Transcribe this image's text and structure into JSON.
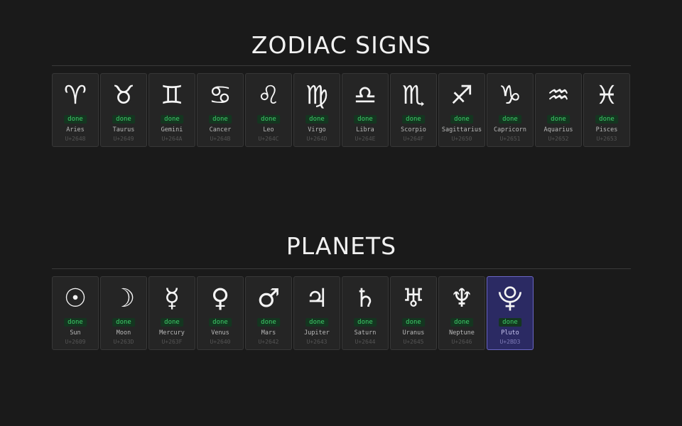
{
  "zodiac": {
    "title": "ZODIAC SIGNS",
    "items": [
      {
        "glyph": "♈",
        "status": "done",
        "name": "Aries",
        "code": "U+2648"
      },
      {
        "glyph": "♉",
        "status": "done",
        "name": "Taurus",
        "code": "U+2649"
      },
      {
        "glyph": "♊",
        "status": "done",
        "name": "Gemini",
        "code": "U+264A"
      },
      {
        "glyph": "♋",
        "status": "done",
        "name": "Cancer",
        "code": "U+264B"
      },
      {
        "glyph": "♌",
        "status": "done",
        "name": "Leo",
        "code": "U+264C"
      },
      {
        "glyph": "♍",
        "status": "done",
        "name": "Virgo",
        "code": "U+264D"
      },
      {
        "glyph": "♎",
        "status": "done",
        "name": "Libra",
        "code": "U+264E"
      },
      {
        "glyph": "♏",
        "status": "done",
        "name": "Scorpio",
        "code": "U+264F"
      },
      {
        "glyph": "♐",
        "status": "done",
        "name": "Sagittarius",
        "code": "U+2650"
      },
      {
        "glyph": "♑",
        "status": "done",
        "name": "Capricorn",
        "code": "U+2651"
      },
      {
        "glyph": "♒",
        "status": "done",
        "name": "Aquarius",
        "code": "U+2652"
      },
      {
        "glyph": "♓",
        "status": "done",
        "name": "Pisces",
        "code": "U+2653"
      }
    ]
  },
  "planets": {
    "title": "PLANETS",
    "items": [
      {
        "glyph": "☉",
        "status": "done",
        "name": "Sun",
        "code": "U+2609"
      },
      {
        "glyph": "☽",
        "status": "done",
        "name": "Moon",
        "code": "U+263D"
      },
      {
        "glyph": "☿",
        "status": "done",
        "name": "Mercury",
        "code": "U+263F"
      },
      {
        "glyph": "♀",
        "status": "done",
        "name": "Venus",
        "code": "U+2640"
      },
      {
        "glyph": "♂",
        "status": "done",
        "name": "Mars",
        "code": "U+2642"
      },
      {
        "glyph": "♃",
        "status": "done",
        "name": "Jupiter",
        "code": "U+2643"
      },
      {
        "glyph": "♄",
        "status": "done",
        "name": "Saturn",
        "code": "U+2644"
      },
      {
        "glyph": "♅",
        "status": "done",
        "name": "Uranus",
        "code": "U+2645"
      },
      {
        "glyph": "♆",
        "status": "done",
        "name": "Neptune",
        "code": "U+2646"
      },
      {
        "glyph": "⯓",
        "status": "done",
        "name": "Pluto",
        "code": "U+2BD3",
        "selected": true
      }
    ]
  }
}
